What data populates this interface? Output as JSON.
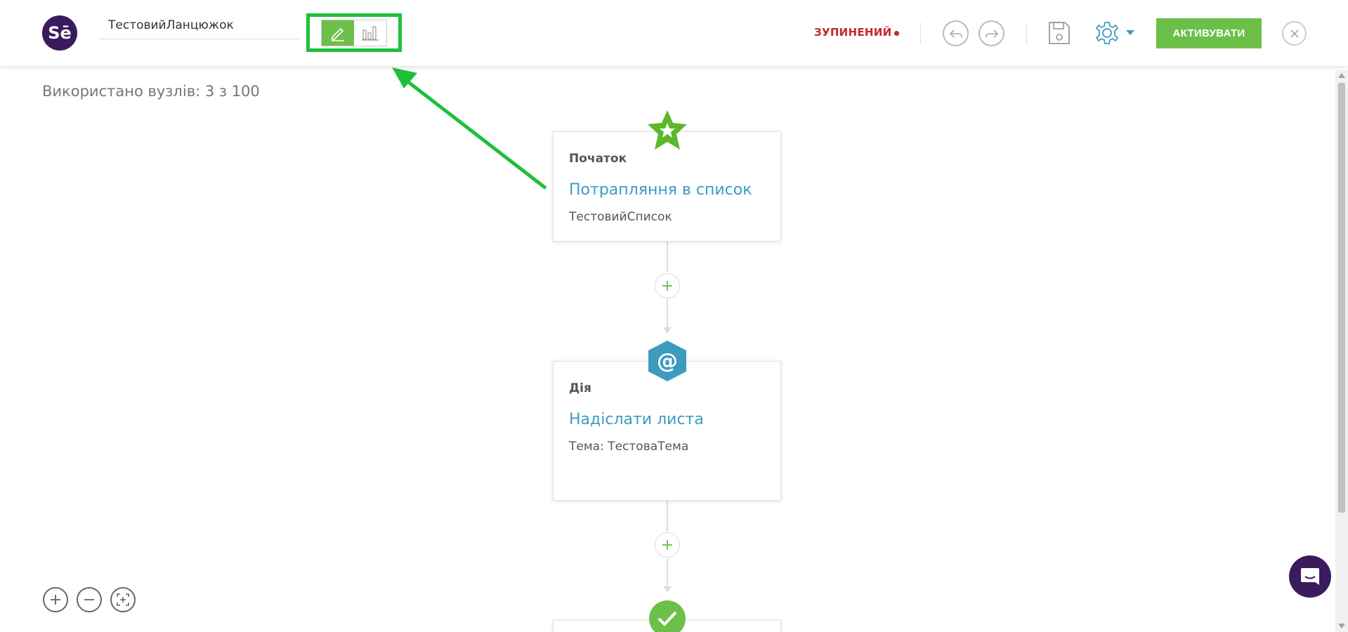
{
  "header": {
    "logo_text": "Sē",
    "chain_name": "ТестовийЛанцюжок",
    "status": "ЗУПИНЕНИЙ",
    "activate_label": "АКТИВУВАТИ"
  },
  "canvas": {
    "nodes_used": "Використано вузлів: 3 з 100",
    "nodes": [
      {
        "type": "Початок",
        "title": "Потрапляння в список",
        "desc": "ТестовийСписок",
        "icon": "star-icon"
      },
      {
        "type": "Дія",
        "title": "Надіслати листа",
        "desc": "Тема: ТестоваТема",
        "icon": "at-sign-icon"
      },
      {
        "icon": "check-icon"
      }
    ],
    "plus_label": "+"
  },
  "colors": {
    "brand_purple": "#3b1a5e",
    "accent_green": "#6cc04a",
    "highlight_green": "#1fbf3c",
    "status_red": "#c62828",
    "link_blue": "#3c9bbf",
    "settings_blue": "#3c9bbf"
  }
}
